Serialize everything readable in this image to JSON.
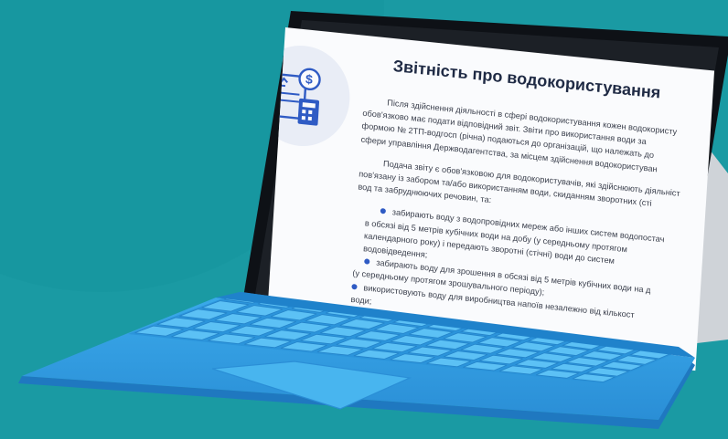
{
  "page": {
    "colors": {
      "background": "#1a9aa3",
      "tablet_bezel": "#111418",
      "screen_bg": "#fafbfd",
      "keyboard": "#2f9de0",
      "keyboard_dark": "#1f78c0",
      "bullet": "#2f5bc4"
    }
  },
  "document": {
    "title": "Звітність про водокористування",
    "icon": "report-money-calculator-icon",
    "paragraphs": [
      [
        "Після здійснення діяльності в сфері водокористування кожен водокористу",
        "обов'язково має подати відповідний звіт. Звіти про використання води за",
        "формою № 2ТП-водгосп (річна) подаються до організацій, що належать до",
        "сфери управління Держводагентства, за місцем здійснення водокористуван"
      ],
      [
        "Подача звіту є обов'язковою для водокористувачів, які здійснюють діяльніст",
        "пов'язану із забором та/або використанням води, скиданням зворотних (сті",
        "вод та забруднюючих речовин, та:"
      ]
    ],
    "bullets": [
      [
        "забирають воду з водопровідних мереж або інших систем водопостач",
        "в обсязі від 5 метрів кубічних води на добу (у середньому протягом",
        "календарного року) і передають зворотні (стічні) води до систем",
        "водовідведення;"
      ],
      [
        "забирають воду для зрошення в обсязі від 5 метрів кубічних води на д",
        "(у середньому протягом зрошувального періоду);"
      ],
      [
        "використовують воду для виробництва напоїв незалежно від кількост",
        "води;"
      ]
    ]
  }
}
